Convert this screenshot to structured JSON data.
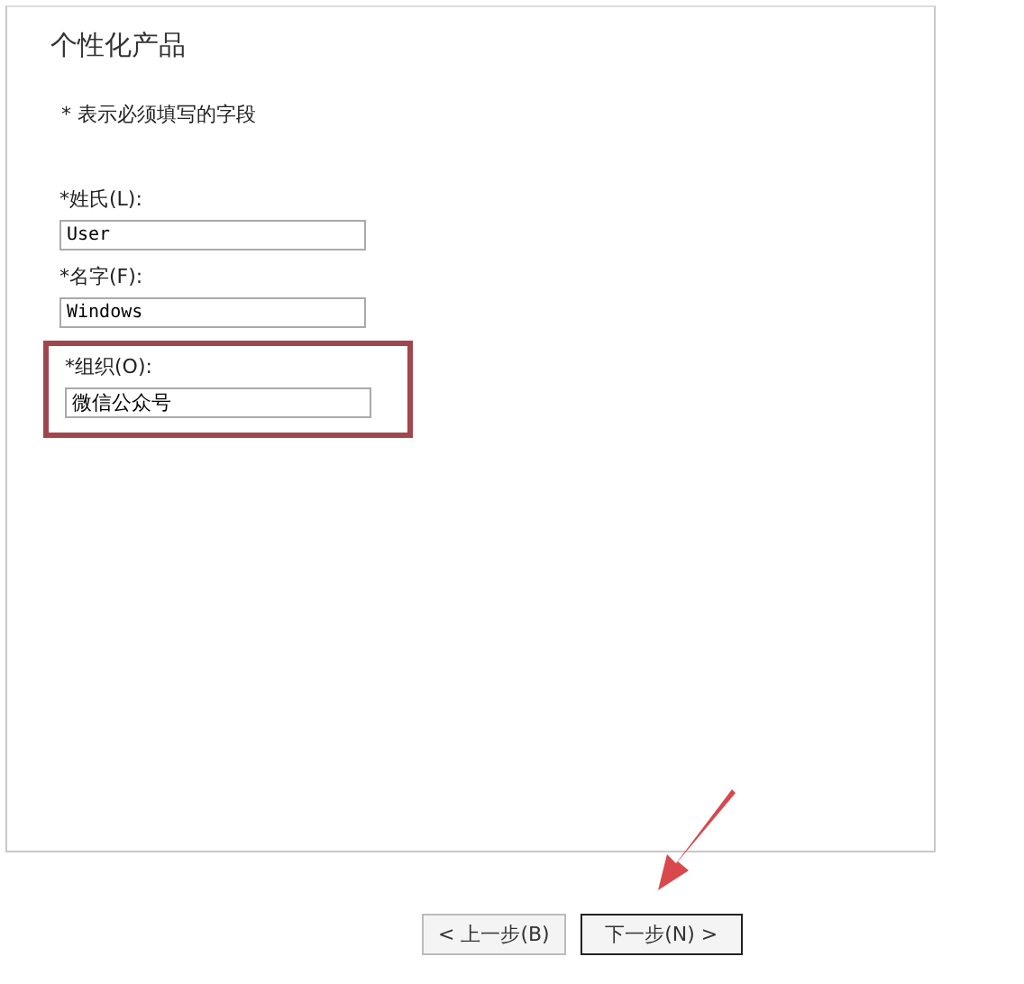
{
  "title": "个性化产品",
  "note": "* 表示必须填写的字段",
  "fields": [
    {
      "label": "*姓氏(L):",
      "value": "User",
      "highlighted": false
    },
    {
      "label": "*名字(F):",
      "value": "Windows",
      "highlighted": false
    },
    {
      "label": "*组织(O):",
      "value": "微信公众号",
      "highlighted": true
    }
  ],
  "buttons": [
    {
      "label": "< 上一步(B)",
      "default": false
    },
    {
      "label": "下一步(N) >",
      "default": true
    }
  ]
}
